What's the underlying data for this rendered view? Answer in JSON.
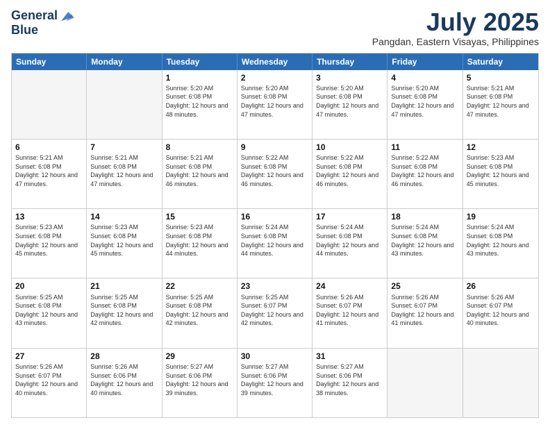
{
  "header": {
    "logo_line1": "General",
    "logo_line2": "Blue",
    "title": "July 2025",
    "subtitle": "Pangdan, Eastern Visayas, Philippines"
  },
  "weekdays": [
    "Sunday",
    "Monday",
    "Tuesday",
    "Wednesday",
    "Thursday",
    "Friday",
    "Saturday"
  ],
  "weeks": [
    [
      {
        "day": "",
        "sunrise": "",
        "sunset": "",
        "daylight": ""
      },
      {
        "day": "",
        "sunrise": "",
        "sunset": "",
        "daylight": ""
      },
      {
        "day": "1",
        "sunrise": "Sunrise: 5:20 AM",
        "sunset": "Sunset: 6:08 PM",
        "daylight": "Daylight: 12 hours and 48 minutes."
      },
      {
        "day": "2",
        "sunrise": "Sunrise: 5:20 AM",
        "sunset": "Sunset: 6:08 PM",
        "daylight": "Daylight: 12 hours and 47 minutes."
      },
      {
        "day": "3",
        "sunrise": "Sunrise: 5:20 AM",
        "sunset": "Sunset: 6:08 PM",
        "daylight": "Daylight: 12 hours and 47 minutes."
      },
      {
        "day": "4",
        "sunrise": "Sunrise: 5:20 AM",
        "sunset": "Sunset: 6:08 PM",
        "daylight": "Daylight: 12 hours and 47 minutes."
      },
      {
        "day": "5",
        "sunrise": "Sunrise: 5:21 AM",
        "sunset": "Sunset: 6:08 PM",
        "daylight": "Daylight: 12 hours and 47 minutes."
      }
    ],
    [
      {
        "day": "6",
        "sunrise": "Sunrise: 5:21 AM",
        "sunset": "Sunset: 6:08 PM",
        "daylight": "Daylight: 12 hours and 47 minutes."
      },
      {
        "day": "7",
        "sunrise": "Sunrise: 5:21 AM",
        "sunset": "Sunset: 6:08 PM",
        "daylight": "Daylight: 12 hours and 47 minutes."
      },
      {
        "day": "8",
        "sunrise": "Sunrise: 5:21 AM",
        "sunset": "Sunset: 6:08 PM",
        "daylight": "Daylight: 12 hours and 46 minutes."
      },
      {
        "day": "9",
        "sunrise": "Sunrise: 5:22 AM",
        "sunset": "Sunset: 6:08 PM",
        "daylight": "Daylight: 12 hours and 46 minutes."
      },
      {
        "day": "10",
        "sunrise": "Sunrise: 5:22 AM",
        "sunset": "Sunset: 6:08 PM",
        "daylight": "Daylight: 12 hours and 46 minutes."
      },
      {
        "day": "11",
        "sunrise": "Sunrise: 5:22 AM",
        "sunset": "Sunset: 6:08 PM",
        "daylight": "Daylight: 12 hours and 46 minutes."
      },
      {
        "day": "12",
        "sunrise": "Sunrise: 5:23 AM",
        "sunset": "Sunset: 6:08 PM",
        "daylight": "Daylight: 12 hours and 45 minutes."
      }
    ],
    [
      {
        "day": "13",
        "sunrise": "Sunrise: 5:23 AM",
        "sunset": "Sunset: 6:08 PM",
        "daylight": "Daylight: 12 hours and 45 minutes."
      },
      {
        "day": "14",
        "sunrise": "Sunrise: 5:23 AM",
        "sunset": "Sunset: 6:08 PM",
        "daylight": "Daylight: 12 hours and 45 minutes."
      },
      {
        "day": "15",
        "sunrise": "Sunrise: 5:23 AM",
        "sunset": "Sunset: 6:08 PM",
        "daylight": "Daylight: 12 hours and 44 minutes."
      },
      {
        "day": "16",
        "sunrise": "Sunrise: 5:24 AM",
        "sunset": "Sunset: 6:08 PM",
        "daylight": "Daylight: 12 hours and 44 minutes."
      },
      {
        "day": "17",
        "sunrise": "Sunrise: 5:24 AM",
        "sunset": "Sunset: 6:08 PM",
        "daylight": "Daylight: 12 hours and 44 minutes."
      },
      {
        "day": "18",
        "sunrise": "Sunrise: 5:24 AM",
        "sunset": "Sunset: 6:08 PM",
        "daylight": "Daylight: 12 hours and 43 minutes."
      },
      {
        "day": "19",
        "sunrise": "Sunrise: 5:24 AM",
        "sunset": "Sunset: 6:08 PM",
        "daylight": "Daylight: 12 hours and 43 minutes."
      }
    ],
    [
      {
        "day": "20",
        "sunrise": "Sunrise: 5:25 AM",
        "sunset": "Sunset: 6:08 PM",
        "daylight": "Daylight: 12 hours and 43 minutes."
      },
      {
        "day": "21",
        "sunrise": "Sunrise: 5:25 AM",
        "sunset": "Sunset: 6:08 PM",
        "daylight": "Daylight: 12 hours and 42 minutes."
      },
      {
        "day": "22",
        "sunrise": "Sunrise: 5:25 AM",
        "sunset": "Sunset: 6:08 PM",
        "daylight": "Daylight: 12 hours and 42 minutes."
      },
      {
        "day": "23",
        "sunrise": "Sunrise: 5:25 AM",
        "sunset": "Sunset: 6:07 PM",
        "daylight": "Daylight: 12 hours and 42 minutes."
      },
      {
        "day": "24",
        "sunrise": "Sunrise: 5:26 AM",
        "sunset": "Sunset: 6:07 PM",
        "daylight": "Daylight: 12 hours and 41 minutes."
      },
      {
        "day": "25",
        "sunrise": "Sunrise: 5:26 AM",
        "sunset": "Sunset: 6:07 PM",
        "daylight": "Daylight: 12 hours and 41 minutes."
      },
      {
        "day": "26",
        "sunrise": "Sunrise: 5:26 AM",
        "sunset": "Sunset: 6:07 PM",
        "daylight": "Daylight: 12 hours and 40 minutes."
      }
    ],
    [
      {
        "day": "27",
        "sunrise": "Sunrise: 5:26 AM",
        "sunset": "Sunset: 6:07 PM",
        "daylight": "Daylight: 12 hours and 40 minutes."
      },
      {
        "day": "28",
        "sunrise": "Sunrise: 5:26 AM",
        "sunset": "Sunset: 6:06 PM",
        "daylight": "Daylight: 12 hours and 40 minutes."
      },
      {
        "day": "29",
        "sunrise": "Sunrise: 5:27 AM",
        "sunset": "Sunset: 6:06 PM",
        "daylight": "Daylight: 12 hours and 39 minutes."
      },
      {
        "day": "30",
        "sunrise": "Sunrise: 5:27 AM",
        "sunset": "Sunset: 6:06 PM",
        "daylight": "Daylight: 12 hours and 39 minutes."
      },
      {
        "day": "31",
        "sunrise": "Sunrise: 5:27 AM",
        "sunset": "Sunset: 6:06 PM",
        "daylight": "Daylight: 12 hours and 38 minutes."
      },
      {
        "day": "",
        "sunrise": "",
        "sunset": "",
        "daylight": ""
      },
      {
        "day": "",
        "sunrise": "",
        "sunset": "",
        "daylight": ""
      }
    ]
  ]
}
